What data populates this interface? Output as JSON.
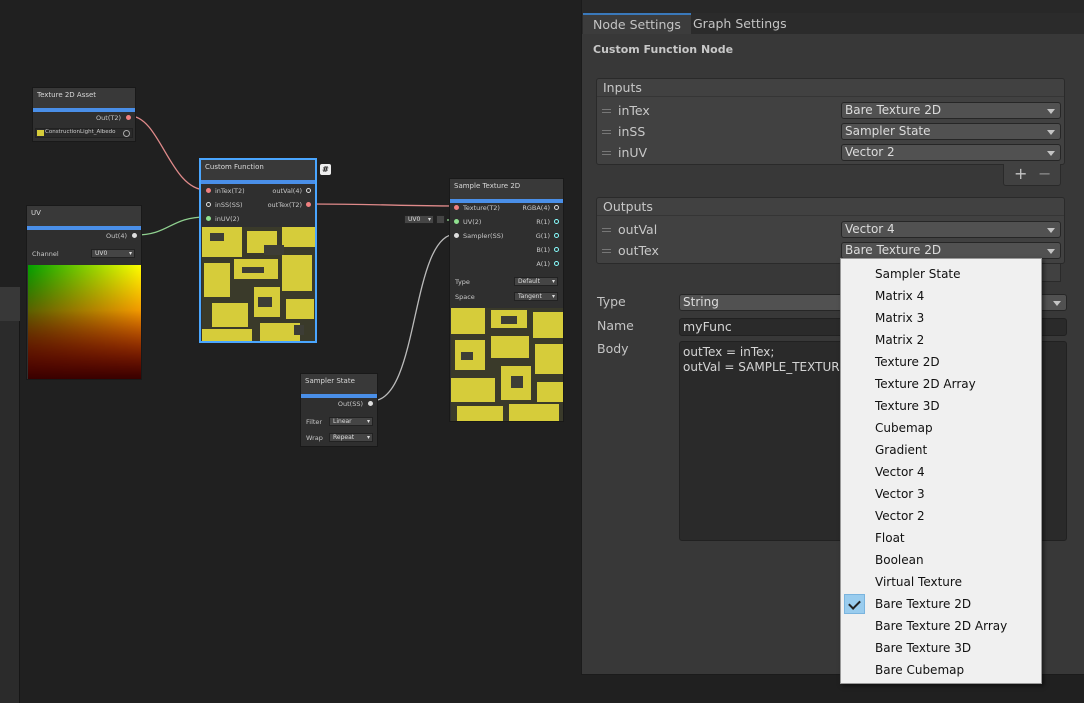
{
  "graph": {
    "texture_asset_node": {
      "title": "Texture 2D Asset",
      "out_port": "Out(T2)",
      "asset_name": "ConstructionLight_Albedo"
    },
    "uv_node": {
      "title": "UV",
      "out_port": "Out(4)",
      "channel_label": "Channel",
      "channel_value": "UV0"
    },
    "custom_function_node": {
      "title": "Custom Function",
      "inputs": [
        "inTex(T2)",
        "inSS(SS)",
        "inUV(2)"
      ],
      "outputs": [
        "outVal(4)",
        "outTex(T2)"
      ]
    },
    "sampler_state_node": {
      "title": "Sampler State",
      "out_port": "Out(SS)",
      "filter_label": "Filter",
      "filter_value": "Linear",
      "wrap_label": "Wrap",
      "wrap_value": "Repeat"
    },
    "sample_texture_node": {
      "title": "Sample Texture 2D",
      "inputs": [
        "Texture(T2)",
        "UV(2)",
        "Sampler(SS)"
      ],
      "outputs": [
        "RGBA(4)",
        "R(1)",
        "G(1)",
        "B(1)",
        "A(1)"
      ],
      "uv_inline": "UV0",
      "type_label": "Type",
      "type_value": "Default",
      "space_label": "Space",
      "space_value": "Tangent"
    }
  },
  "inspector": {
    "tabs": [
      "Node Settings",
      "Graph Settings"
    ],
    "section_title": "Custom Function Node",
    "inputs_header": "Inputs",
    "inputs": [
      {
        "name": "inTex",
        "type": "Bare Texture 2D"
      },
      {
        "name": "inSS",
        "type": "Sampler State"
      },
      {
        "name": "inUV",
        "type": "Vector 2"
      }
    ],
    "plus": "+",
    "minus": "−",
    "outputs_header": "Outputs",
    "outputs": [
      {
        "name": "outVal",
        "type": "Vector 4"
      },
      {
        "name": "outTex",
        "type": "Bare Texture 2D"
      }
    ],
    "type_label": "Type",
    "type_value": "String",
    "name_label": "Name",
    "name_value": "myFunc",
    "body_label": "Body",
    "body_value": "outTex = inTex;\noutVal = SAMPLE_TEXTURE"
  },
  "type_menu": {
    "items": [
      "Sampler State",
      "Matrix 4",
      "Matrix 3",
      "Matrix 2",
      "Texture 2D",
      "Texture 2D Array",
      "Texture 3D",
      "Cubemap",
      "Gradient",
      "Vector 4",
      "Vector 3",
      "Vector 2",
      "Float",
      "Boolean",
      "Virtual Texture",
      "Bare Texture 2D",
      "Bare Texture 2D Array",
      "Bare Texture 3D",
      "Bare Cubemap"
    ],
    "selected": "Bare Texture 2D"
  },
  "colors": {
    "accent": "#4a8fe8",
    "selection": "#4aa6ff",
    "texture_port": "#f08080",
    "vector2_port": "#8fe08f",
    "menu_check": "#99ccee"
  }
}
